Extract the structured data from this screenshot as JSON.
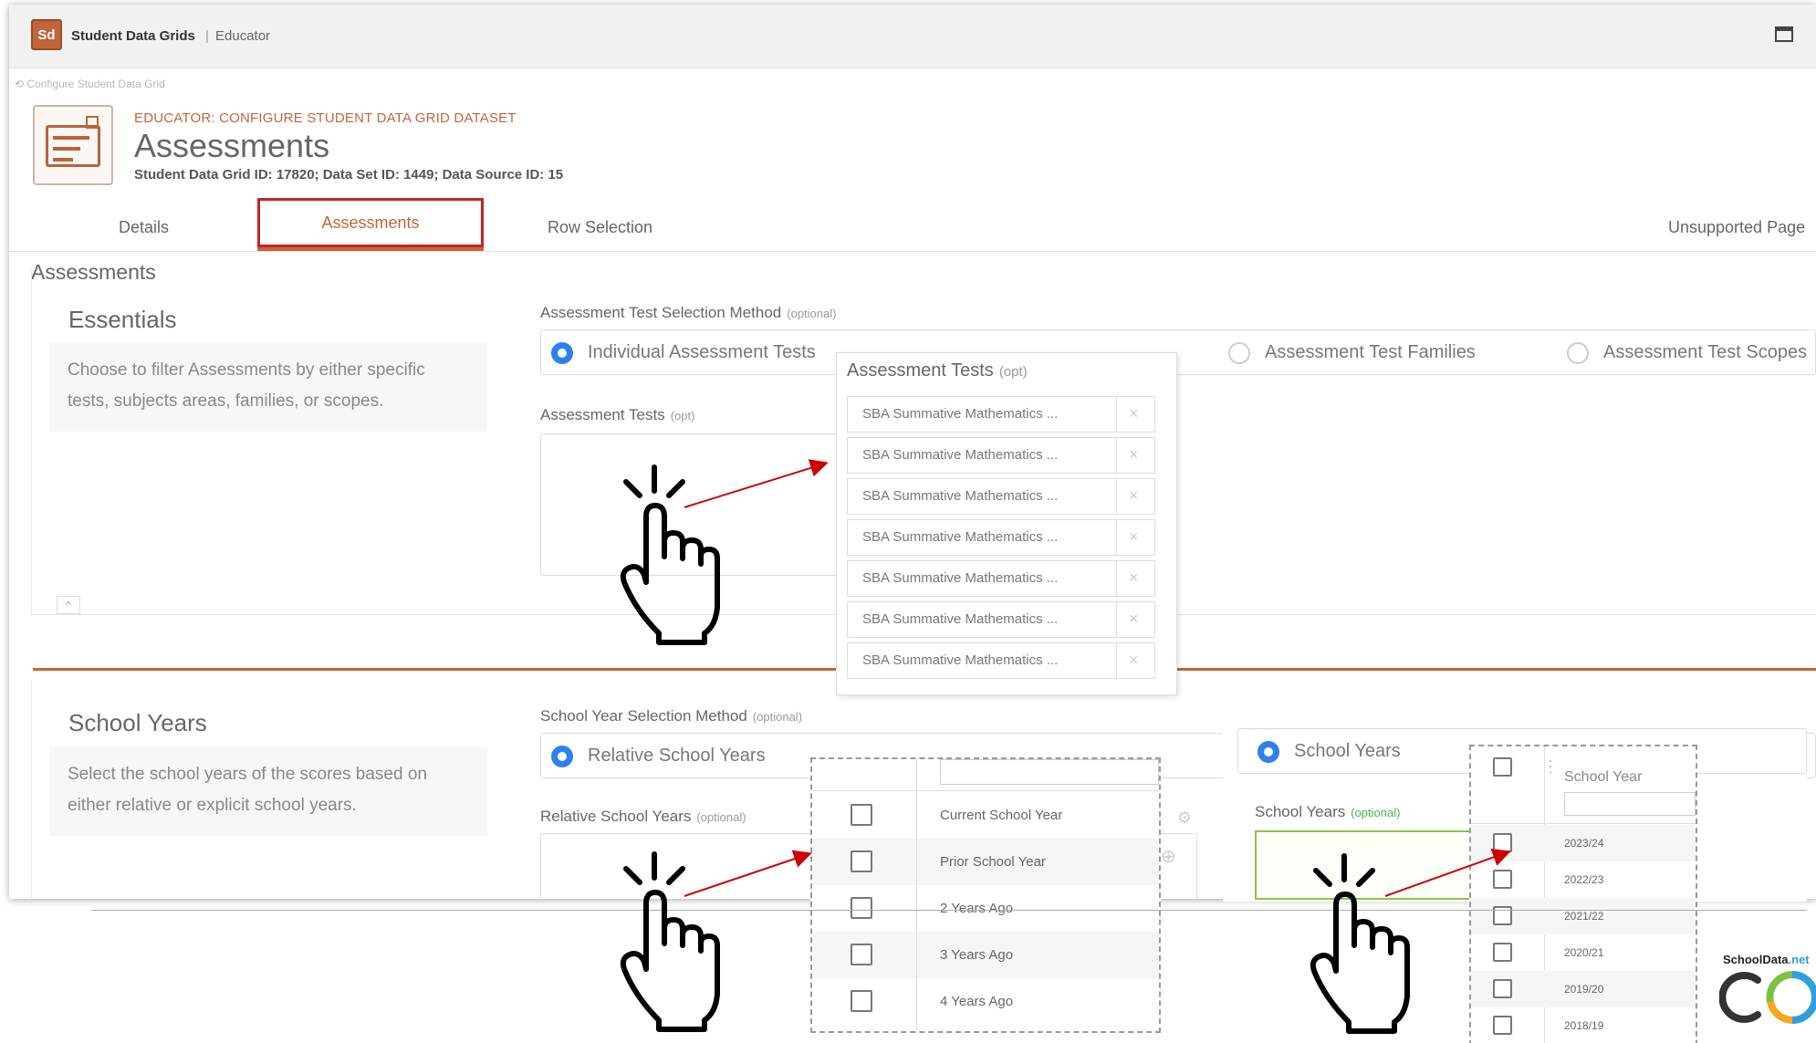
{
  "window": {
    "badge": "Sd",
    "app_name": "Student Data Grids",
    "separator": "|",
    "role": "Educator"
  },
  "breadcrumb": "Configure Student Data Grid",
  "header": {
    "context": "EDUCATOR: CONFIGURE STUDENT DATA GRID DATASET",
    "title": "Assessments",
    "ids": "Student Data Grid ID: 17820; Data Set ID: 1449; Data Source ID: 15"
  },
  "tabs": [
    {
      "label": "Details"
    },
    {
      "label": "Assessments",
      "active": true
    },
    {
      "label": "Row Selection"
    },
    {
      "label": "Unsupported Page"
    }
  ],
  "section_heading": "Assessments",
  "essentials": {
    "title": "Essentials",
    "description": "Choose to filter Assessments by either specific tests, subjects areas, families, or scopes.",
    "method_label": "Assessment Test Selection Method",
    "optional": "(optional)",
    "options": [
      {
        "label": "Individual Assessment Tests",
        "selected": true
      },
      {
        "label": "Assessment Test Families",
        "selected": false
      },
      {
        "label": "Assessment Test Scopes",
        "selected": false
      }
    ],
    "tests_label": "Assessment Tests",
    "tests_opt": "(opt)",
    "collapse_glyph": "^"
  },
  "tests_popup": {
    "title": "Assessment Tests",
    "opt": "(opt)",
    "items": [
      "SBA Summative Mathematics ...",
      "SBA Summative Mathematics ...",
      "SBA Summative Mathematics ...",
      "SBA Summative Mathematics ...",
      "SBA Summative Mathematics ...",
      "SBA Summative Mathematics ...",
      "SBA Summative Mathematics ..."
    ],
    "remove_glyph": "×"
  },
  "school_years": {
    "title": "School Years",
    "description": "Select the school years of the scores based on either relative or explicit school years.",
    "method_label": "School Year Selection Method",
    "optional": "(optional)",
    "relative_option": "Relative School Years",
    "relative_label": "Relative School Years",
    "explicit_option": "School Years",
    "explicit_label": "School Years"
  },
  "relative_popup": {
    "items": [
      "Current School Year",
      "Prior School Year",
      "2 Years Ago",
      "3 Years Ago",
      "4 Years Ago"
    ]
  },
  "school_year_popup": {
    "column": "School Year",
    "items": [
      "2023/24",
      "2022/23",
      "2021/22",
      "2020/21",
      "2019/20",
      "2018/19"
    ]
  },
  "brand": {
    "name": "SchoolData",
    "suffix": ".net"
  },
  "colors": {
    "accent": "#c0663a",
    "highlight": "#cc1f1f",
    "radio": "#2f80ed"
  }
}
